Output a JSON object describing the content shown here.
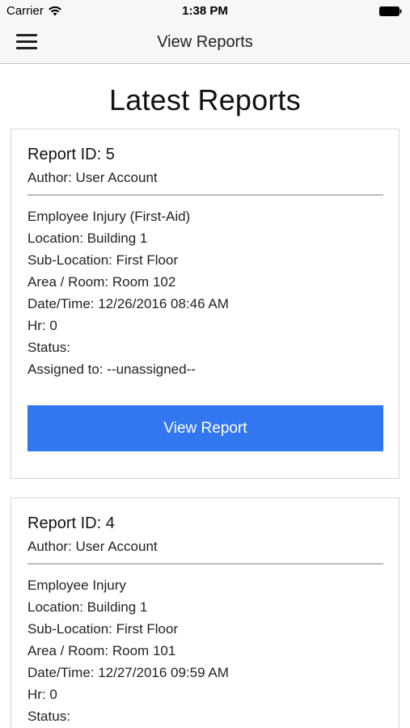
{
  "status_bar": {
    "carrier": "Carrier",
    "time": "1:38 PM"
  },
  "nav": {
    "title": "View Reports",
    "menu_icon": "hamburger-menu-icon"
  },
  "page": {
    "heading": "Latest Reports"
  },
  "colors": {
    "button": "#3377f0",
    "divider": "#bcbcbc",
    "card_border": "#d7d7d7"
  },
  "reports": [
    {
      "id_label": "Report ID: 5",
      "author": "Author: User Account",
      "type": "Employee Injury (First-Aid)",
      "location": "Location: Building 1",
      "sub_location": "Sub-Location: First Floor",
      "area": "Area / Room: Room 102",
      "datetime": "Date/Time: 12/26/2016 08:46 AM",
      "hr": "Hr: 0",
      "status": "Status:",
      "assigned": "Assigned to: --unassigned--",
      "button_label": "View Report"
    },
    {
      "id_label": "Report ID: 4",
      "author": "Author: User Account",
      "type": "Employee Injury",
      "location": "Location: Building 1",
      "sub_location": "Sub-Location: First Floor",
      "area": "Area / Room: Room 101",
      "datetime": "Date/Time: 12/27/2016 09:59 AM",
      "hr": "Hr: 0",
      "status": "Status:"
    }
  ]
}
